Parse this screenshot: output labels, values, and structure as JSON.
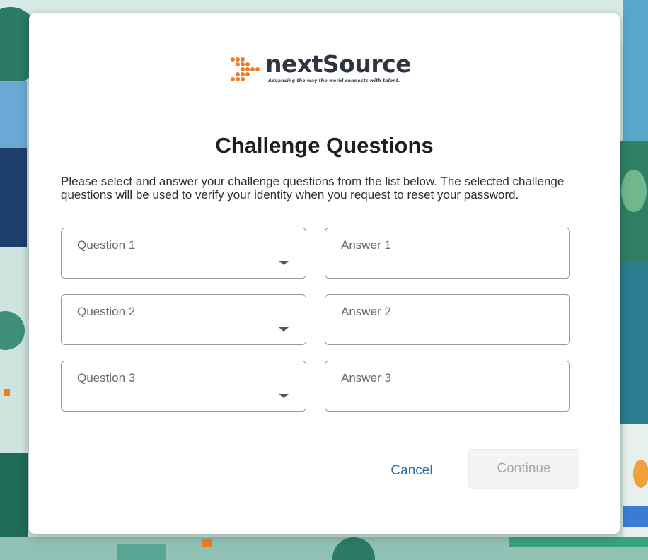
{
  "logo": {
    "brand_name": "nextSource",
    "tagline": "Advancing the way the world connects with talent."
  },
  "dialog": {
    "title": "Challenge Questions",
    "description": "Please select and answer your challenge questions from the list below. The selected challenge questions will be used to verify your identity when you request to reset your password."
  },
  "form": {
    "rows": [
      {
        "question_label": "Question 1",
        "answer_label": "Answer 1"
      },
      {
        "question_label": "Question 2",
        "answer_label": "Answer 2"
      },
      {
        "question_label": "Question 3",
        "answer_label": "Answer 3"
      }
    ]
  },
  "buttons": {
    "cancel_label": "Cancel",
    "continue_label": "Continue"
  },
  "colors": {
    "brand_orange": "#f07b22",
    "link_blue": "#2c6fa8",
    "disabled_text": "#a9a9a9"
  }
}
